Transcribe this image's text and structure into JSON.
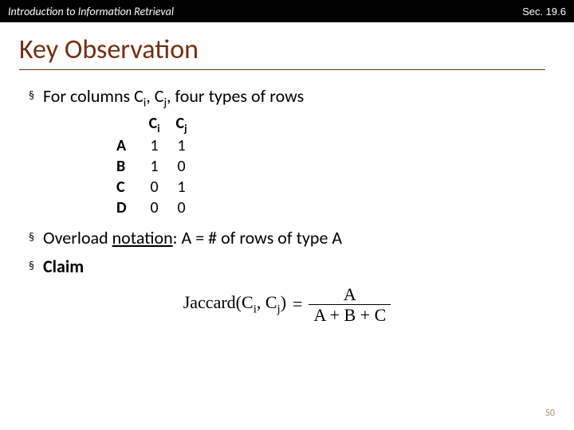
{
  "header": {
    "left": "Introduction to Information Retrieval",
    "right": "Sec. 19.6"
  },
  "title": "Key Observation",
  "bullets": {
    "b1_prefix": "For columns C",
    "b1_mid": ", C",
    "b1_suffix": ", four types of rows",
    "sub_i": "i",
    "sub_j": "j",
    "b2_prefix": "Overload ",
    "b2_underline": "notation",
    "b2_suffix": ": A = # of rows of type A",
    "b3": "Claim"
  },
  "matrix": {
    "col1": "C",
    "col1_sub": "i",
    "col2": "C",
    "col2_sub": "j",
    "rows": [
      {
        "label": "A",
        "c1": "1",
        "c2": "1"
      },
      {
        "label": "B",
        "c1": "1",
        "c2": "0"
      },
      {
        "label": "C",
        "c1": "0",
        "c2": "1"
      },
      {
        "label": "D",
        "c1": "0",
        "c2": "0"
      }
    ]
  },
  "formula": {
    "func": "Jaccard",
    "lparen": "(",
    "arg1": "C",
    "arg1_sub": "i",
    "comma": ", ",
    "arg2": "C",
    "arg2_sub": "j",
    "rparen": ")",
    "eq": "=",
    "num": "A",
    "den": "A + B + C"
  },
  "pagenum": "50"
}
